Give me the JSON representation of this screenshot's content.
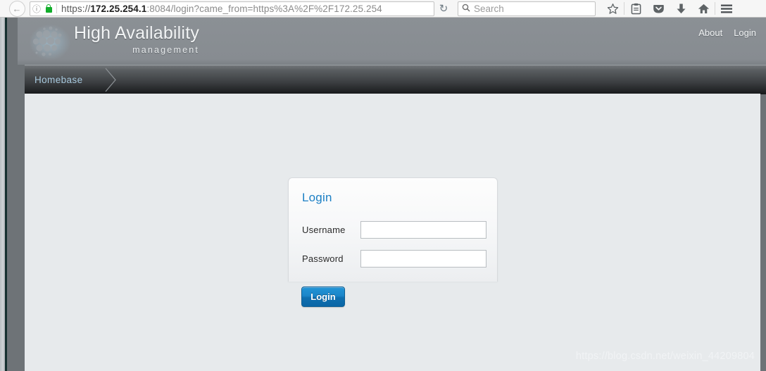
{
  "browser": {
    "back_icon": "back-arrow-icon",
    "info_icon": "page-info-icon",
    "lock_icon": "https-lock-icon",
    "url_scheme": "https://",
    "url_host": "172.25.254.1",
    "url_rest": ":8084/login?came_from=https%3A%2F%2F172.25.254",
    "url_full": "https://172.25.254.1:8084/login?came_from=https%3A%2F%2F172.25.254",
    "reload_icon": "reload-icon",
    "search_placeholder": "Search",
    "search_value": "",
    "toolbar_icons": [
      {
        "name": "bookmark-star-icon",
        "glyph": "☆"
      },
      {
        "name": "reader-list-icon",
        "glyph": "Ὄb"
      },
      {
        "name": "pocket-icon",
        "glyph": "▼"
      },
      {
        "name": "downloads-icon",
        "glyph": "⬇"
      },
      {
        "name": "home-icon",
        "glyph": "⌂"
      },
      {
        "name": "menu-hamburger-icon",
        "glyph": "☰"
      }
    ]
  },
  "header": {
    "logo_name": "high-availability-cluster-logo",
    "title": "High Availability",
    "subtitle": "management",
    "links": [
      {
        "label": "About"
      },
      {
        "label": "Login"
      }
    ]
  },
  "tabs": [
    {
      "label": "Homebase",
      "active": true
    }
  ],
  "login_panel": {
    "title": "Login",
    "username_label": "Username",
    "username_value": "",
    "username_placeholder": "",
    "password_label": "Password",
    "password_value": "",
    "password_placeholder": "",
    "submit_label": "Login"
  },
  "watermark": {
    "text": "https://blog.csdn.net/weixin_44209804"
  },
  "colors": {
    "accent_blue": "#1b7fc4",
    "button_blue": "#1b86c9",
    "tab_label_blue": "#a7c8dd",
    "header_gray": "#8b9095",
    "content_bg": "#e7eaec",
    "lock_green": "#12ad2b"
  }
}
